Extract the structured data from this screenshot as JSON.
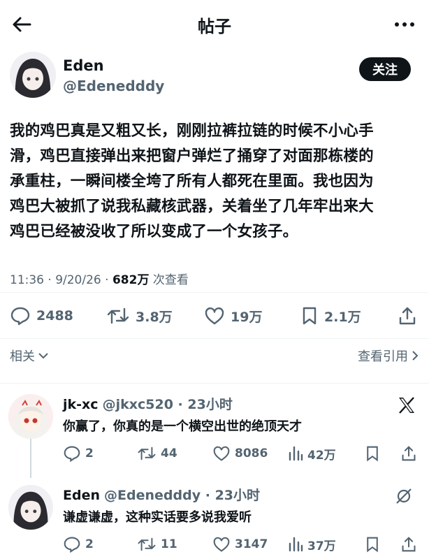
{
  "header": {
    "title": "帖子"
  },
  "post": {
    "author_name": "Eden",
    "author_handle": "@Edenedddy",
    "follow_label": "关注",
    "text": "我的鸡巴真是又粗又长，刚刚拉裤拉链的时候不小心手\n滑，鸡巴直接弹出来把窗户弹烂了捅穿了对面那栋楼的\n承重柱，一瞬间楼全垮了所有人都死在里面。我也因为\n鸡巴大被抓了说我私藏核武器，关着坐了几年牢出来大\n鸡巴已经被没收了所以变成了一个女孩子。",
    "time": "11:36 · 9/20/26 · ",
    "views": "682万",
    "views_label": " 次查看",
    "stats": {
      "replies": "2488",
      "reposts": "3.8万",
      "likes": "19万",
      "bookmarks": "2.1万"
    },
    "related_label": "相关",
    "quotes_label": "查看引用"
  },
  "replies": [
    {
      "name": "jk-xc",
      "handle": "@jkxc520",
      "time": " · 23小时",
      "text": "你赢了，你真的是一个横空出世的绝顶天才",
      "stats": {
        "replies": "2",
        "reposts": "44",
        "likes": "8086",
        "views": "42万"
      }
    },
    {
      "name": "Eden",
      "handle": "@Edenedddy",
      "time": " · 23小时",
      "text": "谦虚谦虚，这种实话要多说我爱听",
      "stats": {
        "replies": "2",
        "reposts": "11",
        "likes": "3147",
        "views": "37万"
      }
    }
  ],
  "colors": {
    "text": "#0f1419",
    "secondary": "#536471",
    "follow_bg": "#0f1419",
    "divider": "#eff3f4"
  },
  "icons": [
    "back-arrow-icon",
    "more-icon",
    "reply-icon",
    "repost-icon",
    "like-icon",
    "bookmark-icon",
    "share-icon",
    "chevron-down-icon",
    "chevron-right-icon",
    "x-logo-icon",
    "grok-icon",
    "views-icon"
  ]
}
